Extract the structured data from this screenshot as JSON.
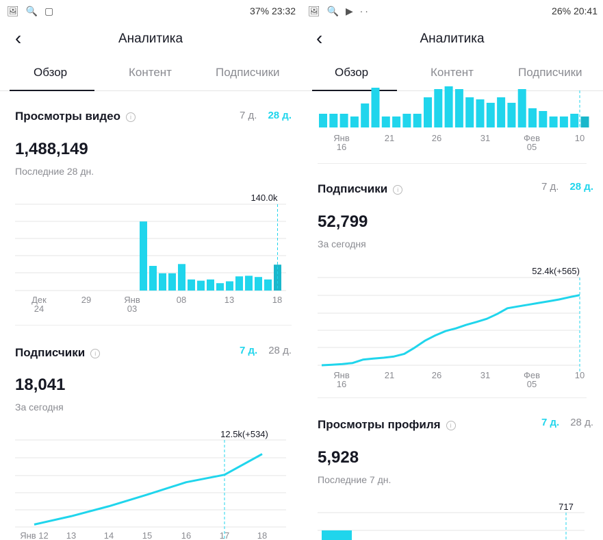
{
  "colors": {
    "accent": "#20d5ec",
    "accent_dark": "#1ab7cb",
    "text": "#161823",
    "muted": "#8a8b91"
  },
  "left": {
    "status": {
      "icons": "🖼 🔍 ▢",
      "right": "37% 23:32"
    },
    "header": {
      "title": "Аналитика"
    },
    "tabs": [
      "Обзор",
      "Контент",
      "Подписчики"
    ],
    "views": {
      "title": "Просмотры видео",
      "range7": "7 д.",
      "range28": "28 д.",
      "active": "28",
      "value": "1,488,149",
      "subtitle": "Последние 28 дн.",
      "chart_data": {
        "type": "bar",
        "ylim": [
          0,
          140
        ],
        "bars": [
          112,
          40,
          28,
          28,
          43,
          18,
          16,
          18,
          12,
          15,
          23,
          24,
          22,
          18,
          42
        ],
        "x_ticks": [
          "Дек 24",
          "29",
          "Янв 03",
          "08",
          "13",
          "18"
        ],
        "annotation": "140.0k"
      }
    },
    "subs": {
      "title": "Подписчики",
      "range7": "7 д.",
      "range28": "28 д.",
      "active": "7",
      "value": "18,041",
      "subtitle": "За сегодня",
      "chart_data": {
        "type": "line",
        "x": [
          "Янв 12",
          "13",
          "14",
          "15",
          "16",
          "17",
          "18"
        ],
        "y": [
          11.93,
          12.03,
          12.15,
          12.29,
          12.44,
          12.53,
          12.78
        ],
        "ylim": [
          11.9,
          12.95
        ],
        "annotation": "12.5k(+534)"
      }
    }
  },
  "right": {
    "status": {
      "icons": "🖼 🔍 ▶ ··",
      "right": "26% 20:41"
    },
    "header": {
      "title": "Аналитика"
    },
    "tabs": [
      "Обзор",
      "Контент",
      "Подписчики"
    ],
    "views_chart": {
      "chart_data": {
        "type": "bar",
        "bars": [
          20,
          20,
          20,
          16,
          35,
          58,
          16,
          16,
          20,
          20,
          44,
          56,
          60,
          56,
          44,
          41,
          36,
          44,
          36,
          56,
          28,
          24,
          16,
          16,
          20,
          16
        ],
        "x_ticks": [
          "Янв 16",
          "21",
          "26",
          "31",
          "Фев 05",
          "10"
        ]
      }
    },
    "subs": {
      "title": "Подписчики",
      "range7": "7 д.",
      "range28": "28 д.",
      "active": "28",
      "value": "52,799",
      "subtitle": "За сегодня",
      "chart_data": {
        "type": "line",
        "x_ticks": [
          "Янв 16",
          "21",
          "26",
          "31",
          "Фев 05",
          "10"
        ],
        "y": [
          48.0,
          48.03,
          48.07,
          48.13,
          48.32,
          48.38,
          48.43,
          48.5,
          48.65,
          49.0,
          49.4,
          49.7,
          49.95,
          50.1,
          50.3,
          50.47,
          50.65,
          50.92,
          51.25,
          51.35,
          51.45,
          51.55,
          51.65,
          51.75,
          51.88,
          52.0
        ],
        "ylim": [
          48.0,
          53.0
        ],
        "annotation": "52.4k(+565)"
      }
    },
    "profile": {
      "title": "Просмотры профиля",
      "range7": "7 д.",
      "range28": "28 д.",
      "active": "7",
      "value": "5,928",
      "subtitle": "Последние 7 дн.",
      "annotation": "717"
    }
  }
}
